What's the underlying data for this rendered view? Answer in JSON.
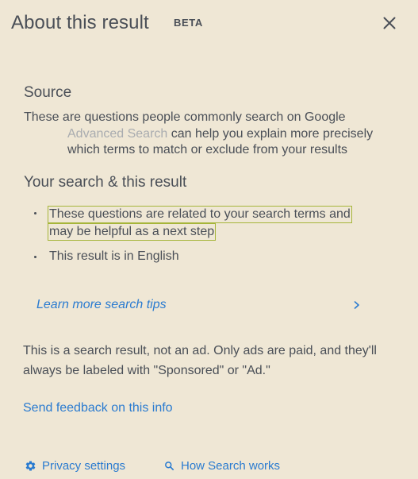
{
  "header": {
    "title": "About this result",
    "badge": "BETA"
  },
  "source": {
    "title": "Source",
    "text": "These are questions people commonly search on Google",
    "advanced_link": "Advanced Search",
    "advanced_rest": " can help you explain more precisely which terms to match or exclude from your results"
  },
  "your_search": {
    "title": "Your search & this result",
    "bullet1_line1": "These questions are related to your search terms and",
    "bullet1_line2": "may be helpful as a next step",
    "bullet2": "This result is in English"
  },
  "learn_more": "Learn more search tips",
  "ad_note": "This is a search result, not an ad. Only ads are paid, and they'll always be labeled with \"Sponsored\" or \"Ad.\"",
  "feedback": "Send feedback on this info",
  "footer": {
    "privacy": "Privacy settings",
    "how": "How Search works"
  },
  "colors": {
    "background": "#efe7d5",
    "text": "#4a4f57",
    "link": "#2a7bd0",
    "highlight_border": "#a6b53a"
  },
  "icons": {
    "close": "close-icon",
    "chevron": "chevron-right-icon",
    "privacy": "gear-icon",
    "how": "search-icon"
  }
}
